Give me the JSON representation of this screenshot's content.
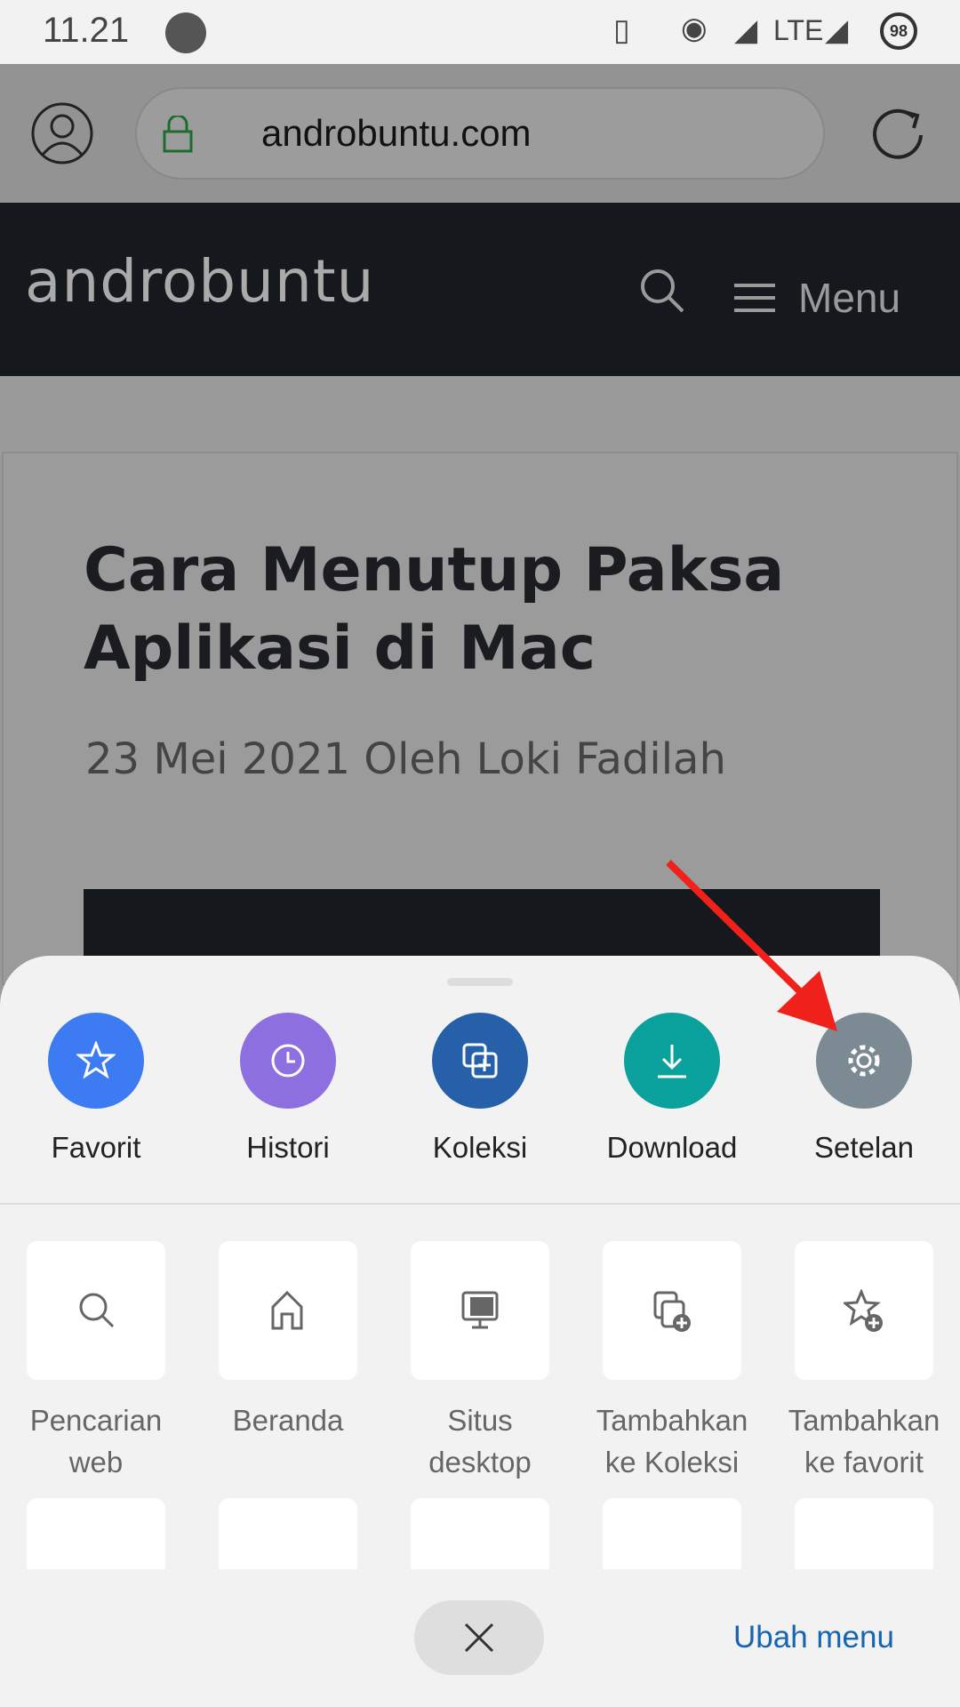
{
  "status_bar": {
    "time": "11.21",
    "network": "LTE",
    "battery": "98"
  },
  "browser": {
    "url": "androbuntu.com"
  },
  "site": {
    "logo": "androbuntu",
    "menu_label": "Menu"
  },
  "article": {
    "title_line1": "Cara Menutup Paksa",
    "title_line2": "Aplikasi di Mac",
    "meta": "23 Mei 2021 Oleh Loki Fadilah"
  },
  "quick_actions": [
    {
      "label": "Favorit",
      "icon": "star-icon",
      "color": "#3d7bf2"
    },
    {
      "label": "Histori",
      "icon": "history-icon",
      "color": "#8e6fe0"
    },
    {
      "label": "Koleksi",
      "icon": "collections-icon",
      "color": "#2560a8"
    },
    {
      "label": "Download",
      "icon": "download-icon",
      "color": "#0aa09c"
    },
    {
      "label": "Setelan",
      "icon": "gear-icon",
      "color": "#7c8b93"
    }
  ],
  "tiles": [
    {
      "line1": "Pencarian",
      "line2": "web",
      "icon": "search-icon"
    },
    {
      "line1": "Beranda",
      "line2": "",
      "icon": "home-icon"
    },
    {
      "line1": "Situs",
      "line2": "desktop",
      "icon": "desktop-icon"
    },
    {
      "line1": "Tambahkan",
      "line2": "ke Koleksi",
      "icon": "add-collection-icon"
    },
    {
      "line1": "Tambahkan",
      "line2": "ke favorit",
      "icon": "add-favorite-icon"
    }
  ],
  "footer": {
    "edit_menu": "Ubah menu",
    "accent": "#1565b0"
  }
}
